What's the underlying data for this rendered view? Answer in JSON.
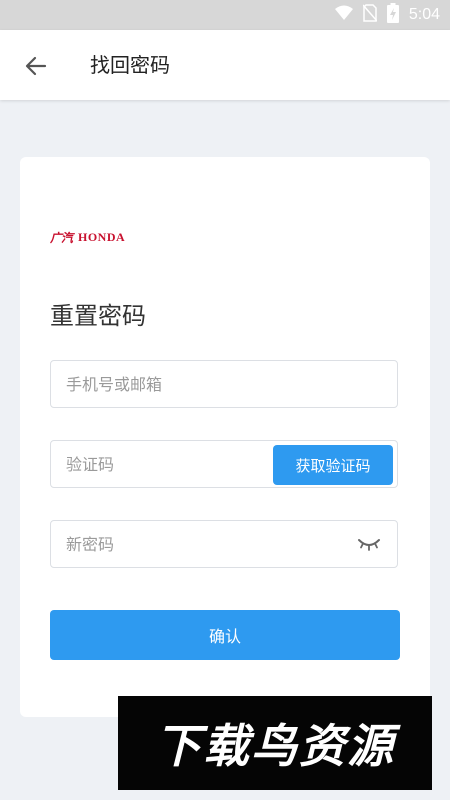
{
  "status_bar": {
    "time": "5:04",
    "icons": [
      "wifi-icon",
      "no-sim-icon",
      "battery-charging-icon"
    ]
  },
  "header": {
    "title": "找回密码",
    "back_icon": "arrow-left-icon"
  },
  "brand": {
    "logo_cn": "广汽",
    "logo_en": "HONDA",
    "color": "#c8102e"
  },
  "form": {
    "heading": "重置密码",
    "account": {
      "value": "",
      "placeholder": "手机号或邮箱"
    },
    "code": {
      "value": "",
      "placeholder": "验证码",
      "button_label": "获取验证码"
    },
    "password": {
      "value": "",
      "placeholder": "新密码",
      "toggle_icon": "eye-closed-icon"
    },
    "confirm_label": "确认"
  },
  "watermark": {
    "text": "下载鸟资源"
  },
  "colors": {
    "accent": "#2e9af0",
    "background": "#eef1f5",
    "card": "#ffffff",
    "status_bar": "#d7d7d7"
  }
}
